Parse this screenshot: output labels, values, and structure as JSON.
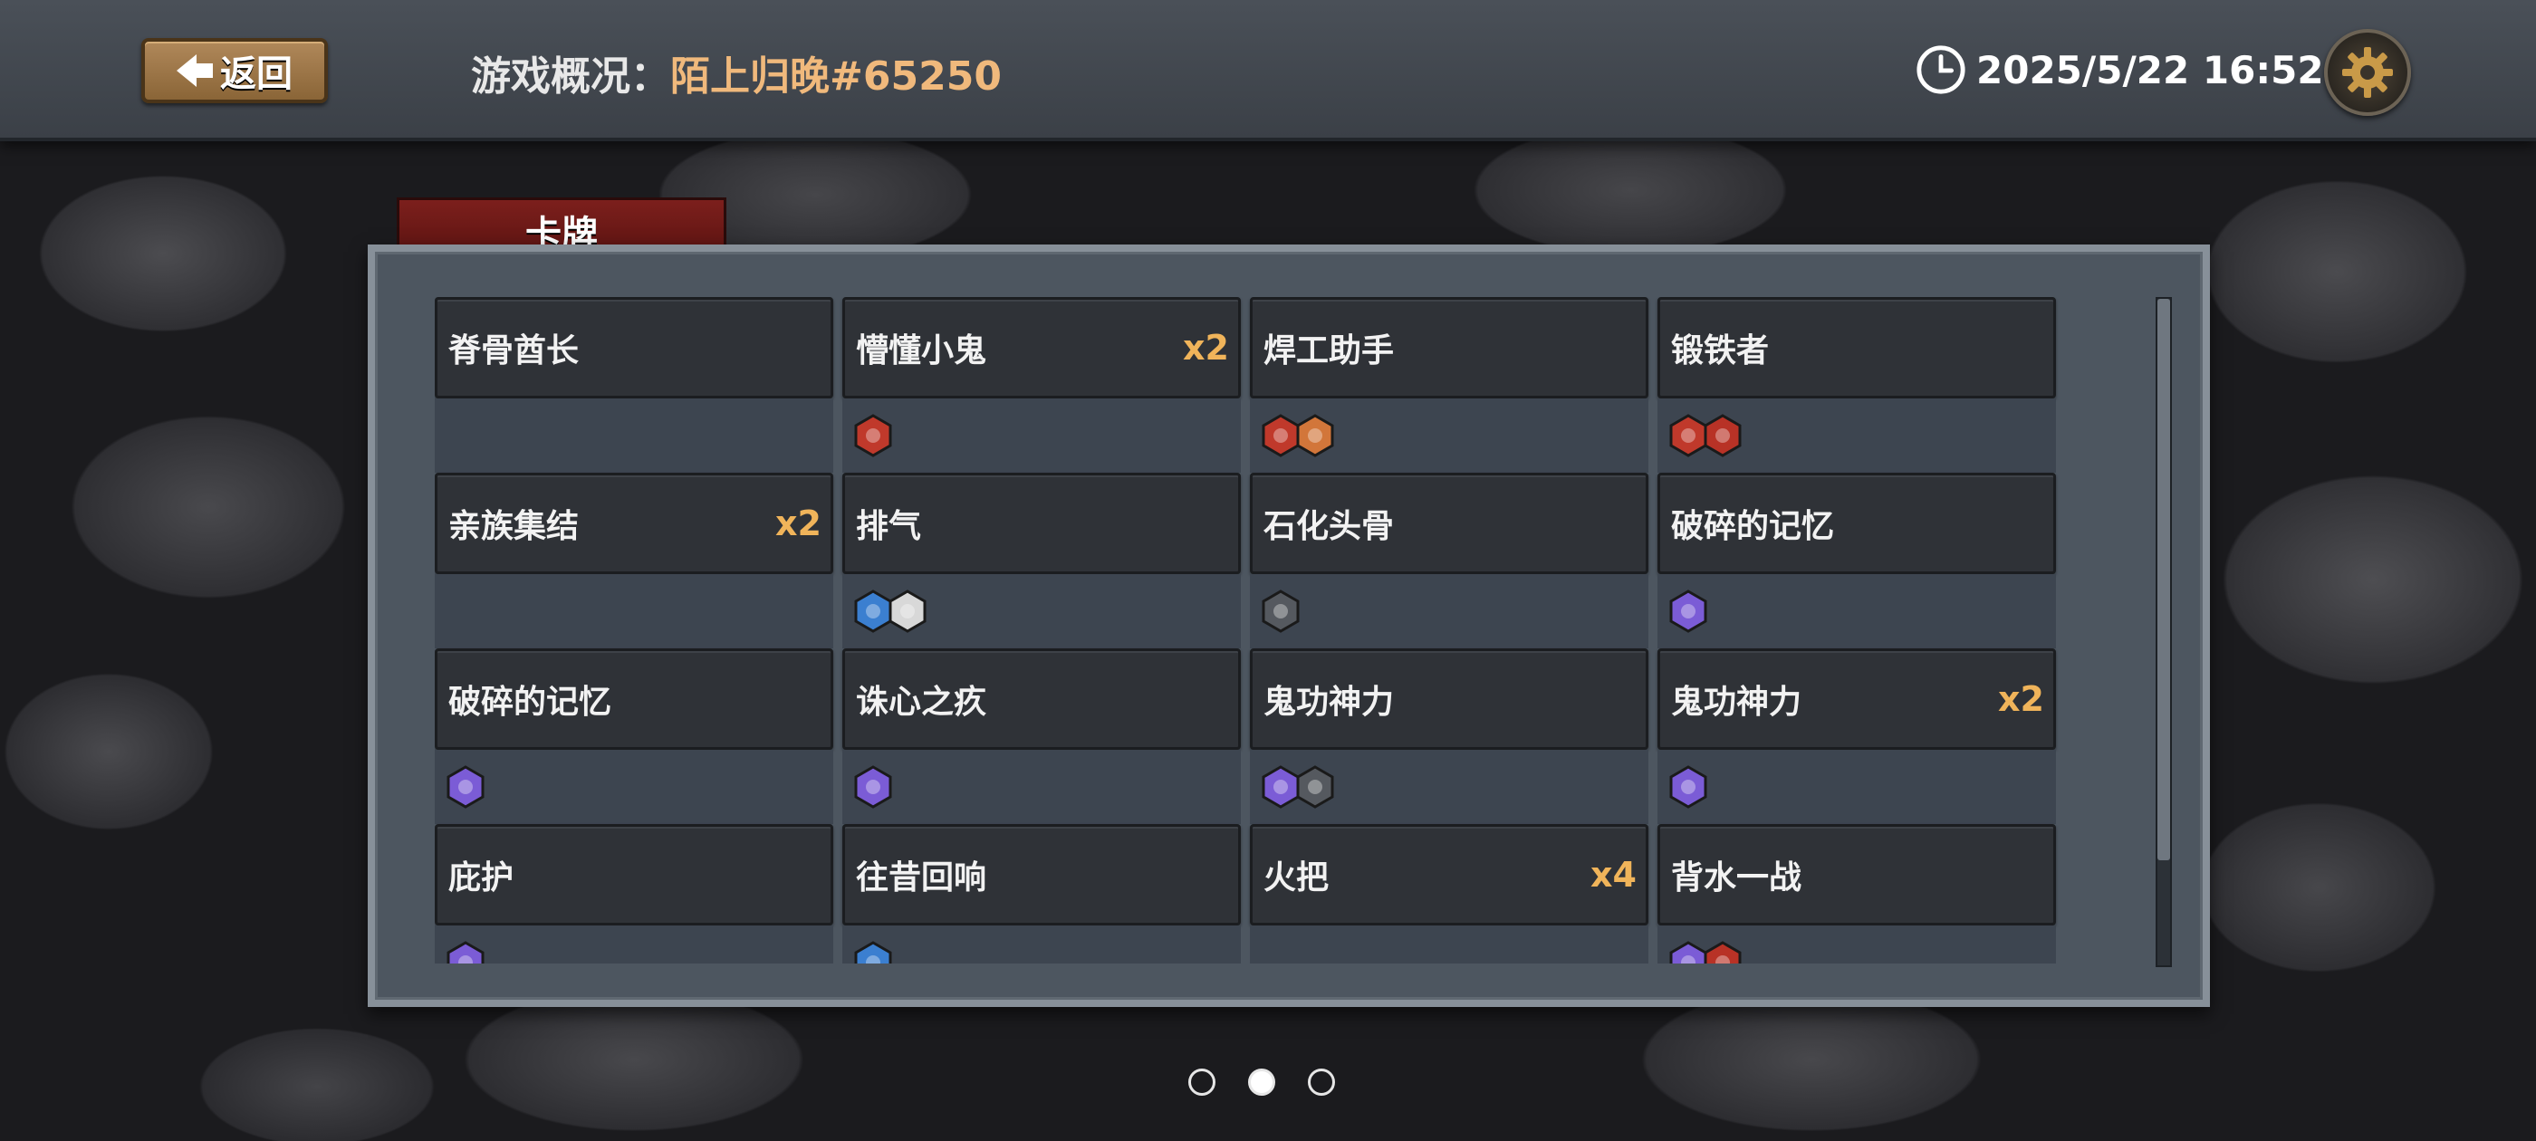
{
  "header": {
    "back_label": "返回",
    "title_label": "游戏概况：",
    "player_name": "陌上归晚#65250",
    "datetime": "2025/5/22 16:52"
  },
  "panel": {
    "tab_label": "卡牌",
    "cards": [
      {
        "name": "脊骨酋长",
        "count": "",
        "icons": []
      },
      {
        "name": "懵懂小鬼",
        "count": "x2",
        "icons": [
          {
            "name": "infinity-rune-icon",
            "color": "#c0392b"
          }
        ]
      },
      {
        "name": "焊工助手",
        "count": "",
        "icons": [
          {
            "name": "infinity-rune-icon",
            "color": "#c0392b"
          },
          {
            "name": "wrench-rune-icon",
            "color": "#d2763a"
          }
        ]
      },
      {
        "name": "锻铁者",
        "count": "",
        "icons": [
          {
            "name": "blade-rune-icon",
            "color": "#c0392b"
          },
          {
            "name": "claw-rune-icon",
            "color": "#b83226"
          }
        ]
      },
      {
        "name": "亲族集结",
        "count": "x2",
        "icons": []
      },
      {
        "name": "排气",
        "count": "",
        "icons": [
          {
            "name": "figure-hex-icon",
            "color": "#3b7fd0"
          },
          {
            "name": "sword-hex-icon",
            "color": "#d8d8d8"
          }
        ]
      },
      {
        "name": "石化头骨",
        "count": "",
        "icons": [
          {
            "name": "skull-hex-icon",
            "color": "#55595f"
          }
        ]
      },
      {
        "name": "破碎的记忆",
        "count": "",
        "icons": [
          {
            "name": "snowflake-hex-icon",
            "color": "#7b5cd6"
          }
        ]
      },
      {
        "name": "破碎的记忆",
        "count": "",
        "icons": [
          {
            "name": "mask-hex-icon",
            "color": "#7b5cd6"
          }
        ]
      },
      {
        "name": "诛心之疚",
        "count": "",
        "icons": [
          {
            "name": "book-hex-icon",
            "color": "#7b5cd6"
          }
        ]
      },
      {
        "name": "鬼功神力",
        "count": "",
        "icons": [
          {
            "name": "scroll-hex-icon",
            "color": "#7b5cd6"
          },
          {
            "name": "skull-hex-icon",
            "color": "#55595f"
          }
        ]
      },
      {
        "name": "鬼功神力",
        "count": "x2",
        "icons": [
          {
            "name": "snowflake-hex-icon",
            "color": "#7b5cd6"
          }
        ]
      },
      {
        "name": "庇护",
        "count": "",
        "icons": [
          {
            "name": "shield-hex-icon",
            "color": "#7b5cd6"
          }
        ]
      },
      {
        "name": "往昔回响",
        "count": "",
        "icons": [
          {
            "name": "flame-hex-icon",
            "color": "#3b7fd0"
          }
        ]
      },
      {
        "name": "火把",
        "count": "x4",
        "icons": []
      },
      {
        "name": "背水一战",
        "count": "",
        "icons": [
          {
            "name": "mask-hex-icon",
            "color": "#7b5cd6"
          },
          {
            "name": "fire-hex-icon",
            "color": "#b83226"
          }
        ]
      }
    ]
  },
  "pagination": {
    "total": 3,
    "current": 2
  },
  "colors": {
    "accent_gold": "#f0b45a",
    "player_name": "#f0b97c",
    "tab_red": "#7c1f1c"
  }
}
